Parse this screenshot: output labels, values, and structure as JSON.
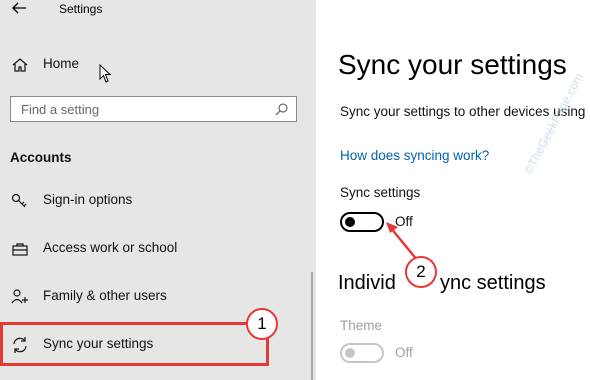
{
  "app": {
    "title": "Settings"
  },
  "sidebar": {
    "home_label": "Home",
    "search_placeholder": "Find a setting",
    "section_heading": "Accounts",
    "items": [
      {
        "label": "Sign-in options",
        "icon": "key-icon"
      },
      {
        "label": "Access work or school",
        "icon": "briefcase-icon"
      },
      {
        "label": "Family & other users",
        "icon": "person-add-icon"
      },
      {
        "label": "Sync your settings",
        "icon": "sync-icon"
      }
    ]
  },
  "main": {
    "title": "Sync your settings",
    "description": "Sync your settings to other devices using",
    "help_link": "How does syncing work?",
    "sync_settings": {
      "label": "Sync settings",
      "state": "Off"
    },
    "individual_heading_left": "Individ",
    "individual_heading_right": "ync settings",
    "theme": {
      "label": "Theme",
      "state": "Off"
    }
  },
  "annotations": {
    "callout_1": "1",
    "callout_2": "2",
    "color": "#e53935"
  },
  "watermark": "©TheGeekPage.com",
  "colors": {
    "sidebar_bg": "#e6e6e6",
    "link": "#0063b1",
    "disabled": "#a0a0a0"
  }
}
